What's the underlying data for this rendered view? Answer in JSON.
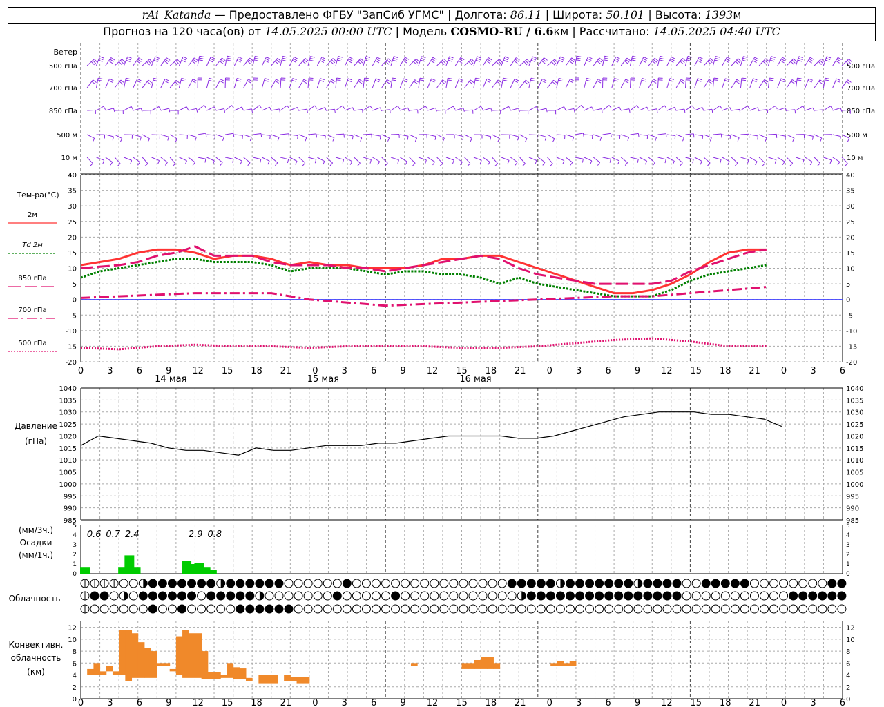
{
  "header": {
    "station": "rAi_Katanda",
    "provider": "— Предоставлено ФГБУ \"ЗапСиб УГМС\"",
    "lon_label": "| Долгота:",
    "lon_value": "86.11",
    "lat_label": "| Широта:",
    "lat_value": "50.101",
    "alt_label": "| Высота:",
    "alt_value": "1393",
    "alt_unit": "м",
    "forecast_label": "Прогноз на 120 часа(ов) от",
    "forecast_start": "14.05.2025 00:00 UTC",
    "model_label": "| Модель",
    "model_name": "COSMO-RU / 6.6",
    "model_unit": "км",
    "calc_label": "| Рассчитано:",
    "calc_time": "14.05.2025 04:40 UTC"
  },
  "colors": {
    "t2m": "#ff3333",
    "td2m": "#008000",
    "t850": "#e0116f",
    "t700": "#e0116f",
    "t500": "#e0116f",
    "wind": "#8a2be2",
    "pressure": "#000000",
    "precip": "#00cc00",
    "convective": "#f0892a",
    "zero_line": "#4040ff",
    "grid": "#999999"
  },
  "time_axis": {
    "hour_labels": [
      "0",
      "3",
      "6",
      "9",
      "12",
      "15",
      "18",
      "21",
      "0",
      "3",
      "6",
      "9",
      "12",
      "15",
      "18",
      "21",
      "0",
      "3",
      "6",
      "9",
      "12",
      "15",
      "18",
      "21",
      "0",
      "3",
      "6"
    ],
    "day_labels": [
      "14 мая",
      "15 мая",
      "16 мая"
    ]
  },
  "wind_panel": {
    "title": "Ветер",
    "levels": [
      "500 гПа",
      "700 гПа",
      "850 гПа",
      "500 м",
      "10 м"
    ],
    "icon": "wind-barb-icon"
  },
  "cloud_panel": {
    "title": "Облачность",
    "rows": [
      "1111002333333323333330000003000000000000000033333233333332333300333330000000033",
      "1330203333330333332000000030000030000000000002333333333333333300000000000333333",
      "1000000300300000333333000000000000000000000000000000000000000000000000000000000"
    ]
  },
  "chart_data": [
    {
      "type": "line",
      "title": "Тем-ра(°C)",
      "x_unit": "hours since 14.05.2025 00:00 UTC",
      "ylim": [
        -20,
        40
      ],
      "yticks": [
        -20,
        -15,
        -10,
        -5,
        0,
        5,
        10,
        15,
        20,
        25,
        30,
        35,
        40
      ],
      "grid": true,
      "series": [
        {
          "name": "2м",
          "style": "solid",
          "x": [
            0,
            3,
            6,
            9,
            12,
            15,
            18,
            21,
            24,
            27,
            30,
            33,
            36,
            39,
            42,
            45,
            48,
            51,
            54,
            57,
            60,
            63,
            66,
            69,
            72,
            75,
            78,
            81,
            84,
            87,
            90,
            93,
            96,
            99,
            102,
            105,
            108
          ],
          "values": [
            11,
            12,
            13,
            15,
            16,
            16,
            15,
            13,
            14,
            14,
            13,
            11,
            12,
            11,
            11,
            10,
            10,
            10,
            11,
            13,
            13,
            14,
            14,
            12,
            10,
            8,
            6,
            4,
            2,
            2,
            3,
            5,
            8,
            12,
            15,
            16,
            16
          ]
        },
        {
          "name": "Td 2м",
          "style": "dotted",
          "x": [
            0,
            3,
            6,
            9,
            12,
            15,
            18,
            21,
            24,
            27,
            30,
            33,
            36,
            39,
            42,
            45,
            48,
            51,
            54,
            57,
            60,
            63,
            66,
            69,
            72,
            75,
            78,
            81,
            84,
            87,
            90,
            93,
            96,
            99,
            102,
            105,
            108
          ],
          "values": [
            7,
            9,
            10,
            11,
            12,
            13,
            13,
            12,
            12,
            12,
            11,
            9,
            10,
            10,
            10,
            9,
            8,
            9,
            9,
            8,
            8,
            7,
            5,
            7,
            5,
            4,
            3,
            2,
            1,
            1,
            1,
            3,
            6,
            8,
            9,
            10,
            11
          ]
        },
        {
          "name": "850 гПа",
          "style": "dashed",
          "x": [
            0,
            6,
            9,
            12,
            15,
            18,
            21,
            24,
            27,
            30,
            33,
            36,
            39,
            42,
            45,
            48,
            51,
            54,
            57,
            60,
            63,
            66,
            69,
            72,
            75,
            78,
            81,
            84,
            87,
            90,
            93,
            96,
            99,
            102,
            105,
            108
          ],
          "values": [
            10,
            11,
            12,
            14,
            15,
            17,
            14,
            14,
            14,
            12,
            11,
            11,
            11,
            10,
            10,
            9,
            10,
            11,
            12,
            13,
            14,
            13,
            10,
            8,
            7,
            6,
            5,
            5,
            5,
            5,
            6,
            9,
            11,
            13,
            15,
            16
          ]
        },
        {
          "name": "700 гПа",
          "style": "dashdot",
          "x": [
            0,
            6,
            12,
            18,
            24,
            30,
            33,
            36,
            42,
            48,
            54,
            60,
            66,
            72,
            78,
            84,
            90,
            96,
            102,
            108
          ],
          "values": [
            0.5,
            1,
            1.5,
            2,
            2,
            2,
            1,
            0,
            -1,
            -2,
            -1.5,
            -1,
            -0.5,
            0,
            0.5,
            1,
            1,
            2,
            3,
            4
          ]
        },
        {
          "name": "500 гПа",
          "style": "dotted-dense",
          "x": [
            0,
            6,
            12,
            18,
            24,
            30,
            36,
            42,
            48,
            54,
            60,
            66,
            72,
            78,
            84,
            90,
            96,
            102,
            108
          ],
          "values": [
            -15.5,
            -16,
            -15,
            -14.5,
            -15,
            -15,
            -15.5,
            -15,
            -15,
            -15,
            -15.5,
            -15.5,
            -15,
            -14,
            -13,
            -12.5,
            -13.5,
            -15,
            -15
          ]
        }
      ]
    },
    {
      "type": "line",
      "title": "Давление",
      "unit_label": "(гПа)",
      "ylim": [
        985,
        1040
      ],
      "yticks": [
        985,
        990,
        995,
        1000,
        1005,
        1010,
        1015,
        1020,
        1025,
        1030,
        1035,
        1040
      ],
      "grid": true,
      "series": [
        {
          "name": "",
          "x": [
            0,
            3,
            6,
            9,
            12,
            15,
            18,
            21,
            24,
            27,
            30,
            33,
            36,
            39,
            42,
            45,
            48,
            51,
            54,
            57,
            60,
            63,
            66,
            69,
            72,
            75,
            78,
            81,
            84,
            87,
            90,
            93,
            96,
            99,
            102,
            105,
            108,
            111,
            114,
            117,
            120
          ],
          "values": [
            1016,
            1020,
            1019,
            1018,
            1017,
            1015,
            1014,
            1014,
            1013,
            1012,
            1015,
            1014,
            1014,
            1015,
            1016,
            1016,
            1016,
            1017,
            1017,
            1018,
            1019,
            1020,
            1020,
            1020,
            1020,
            1019,
            1019,
            1020,
            1022,
            1024,
            1026,
            1028,
            1029,
            1030,
            1030,
            1030,
            1029,
            1029,
            1028,
            1027,
            1024
          ]
        }
      ]
    },
    {
      "type": "bar",
      "title": "Осадки",
      "unit_label_top": "(мм/3ч.)",
      "unit_label_bottom": "(мм/1ч.)",
      "ylim": [
        0,
        5
      ],
      "yticks": [
        0,
        1,
        2,
        3,
        4,
        5
      ],
      "hour_x": [
        0,
        1,
        2,
        3,
        4,
        5,
        6,
        7,
        8,
        9,
        10,
        11,
        12,
        13,
        14,
        15,
        16,
        17,
        18,
        19,
        20,
        21,
        22,
        23,
        24,
        25,
        26,
        27,
        28,
        29,
        30,
        31,
        32,
        33,
        34,
        35,
        36,
        37,
        38,
        39,
        40
      ],
      "values": [
        0.6,
        0,
        0,
        0,
        0,
        0,
        0,
        0,
        0,
        0,
        0,
        0,
        0.8,
        0,
        0,
        0,
        0,
        0,
        0,
        0,
        0,
        0,
        0,
        0,
        0,
        0,
        0,
        0,
        0,
        0,
        0,
        0,
        0,
        0,
        0,
        0,
        0,
        0,
        0,
        0,
        0
      ],
      "three_hour_totals": [
        {
          "hour": 1,
          "label": "0.6"
        },
        {
          "hour": 4,
          "label": "0.7"
        },
        {
          "hour": 7,
          "label": "2.4"
        },
        {
          "hour": 17,
          "label": "2.9"
        },
        {
          "hour": 20,
          "label": "0.8"
        }
      ]
    },
    {
      "type": "bar",
      "title": "Конвективн. облачность",
      "unit_label": "(км)",
      "ylim": [
        0,
        13
      ],
      "yticks": [
        0,
        2,
        4,
        6,
        8,
        10,
        12
      ]
    }
  ]
}
